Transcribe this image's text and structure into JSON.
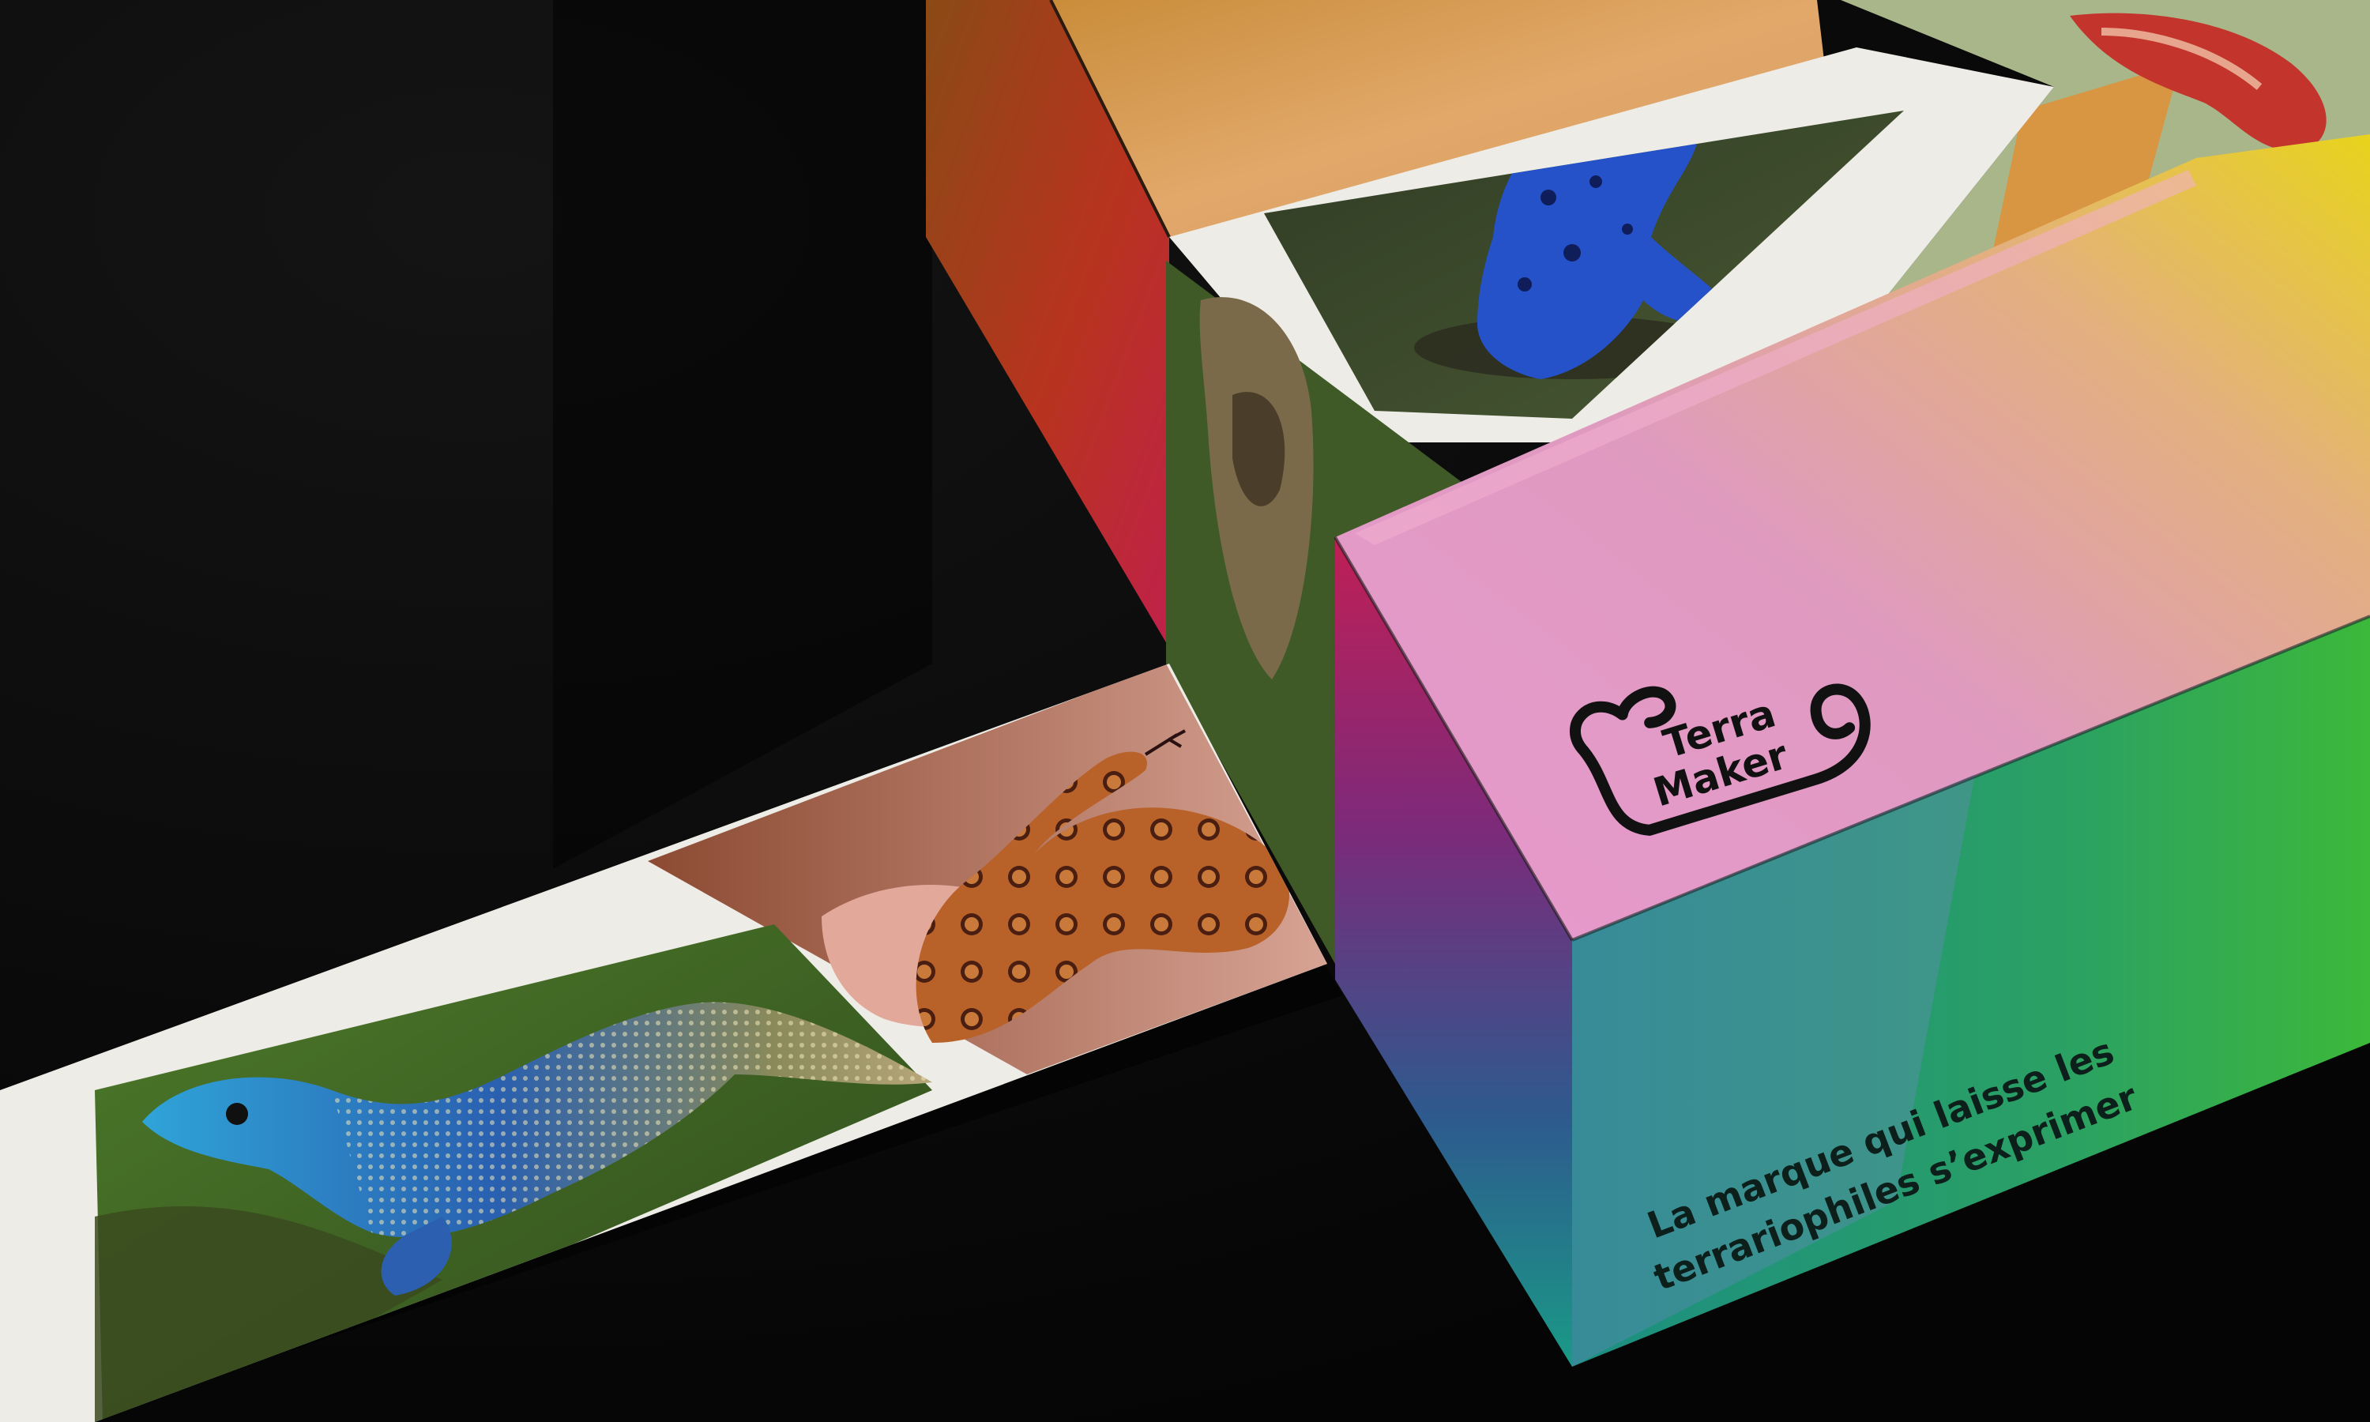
{
  "brand": {
    "name_line1": "Terra",
    "name_line2": "Maker"
  },
  "tagline": {
    "line1": "La marque qui laisse les",
    "line2": "terrariophiles s’exprimer"
  },
  "colors": {
    "background": "#0b0b0b",
    "tagline_text": "#0d1f1a",
    "logo_stroke": "#111111",
    "box_orange": "#d99a52",
    "box_pink": "#e09cc8",
    "box_yellow": "#e8d12a",
    "box_green": "#2ca83e",
    "box_teal": "#1e9a86",
    "frog_blue": "#2552c8",
    "lizard_blue": "#2b8fd6",
    "snake_orange": "#b8622a"
  },
  "scene": {
    "subject": "mockup of a gradient packaging box with reptile and amphibian photos on a dark surface",
    "photos": [
      "chameleon",
      "blue-poison-dart-frog",
      "tortoise",
      "rainbow-boa-snake",
      "blue-headed-agama-lizard"
    ]
  }
}
